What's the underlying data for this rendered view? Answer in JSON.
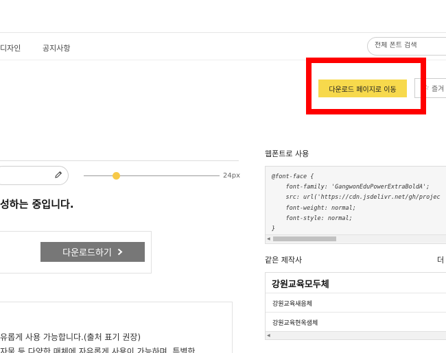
{
  "nav": {
    "items": [
      {
        "label": "디자인"
      },
      {
        "label": "공지사항"
      }
    ]
  },
  "search": {
    "placeholder": "전체 폰트 검색"
  },
  "actions": {
    "download_page_label": "다운로드 페이지로 이동",
    "favorite_label": "즐겨"
  },
  "tester": {
    "size_label": "24px",
    "preview_text": "성하는 중입니다."
  },
  "download": {
    "label": "다운로드하기"
  },
  "license": {
    "lines": [
      "유롭게 사용 가능합니다.(출처 표기 권장)",
      "자물 등 다양한 매체에 자유롭게 사용이 가능하며, 특별한"
    ]
  },
  "webfont": {
    "heading": "웹폰트로 사용",
    "code": "@font-face {\n    font-family: 'GangwonEduPowerExtraBoldA';\n    src: url('https://cdn.jsdelivr.net/gh/projec\n    font-weight: normal;\n    font-style: normal;\n}"
  },
  "same_maker": {
    "heading": "같은 제작사",
    "more_label": "더",
    "title": "강원교육모두체",
    "items": [
      "강원교육새음체",
      "강원교육현옥샘체"
    ]
  },
  "colors": {
    "accent": "#f7d94c",
    "highlight": "#ff0000",
    "button_gray": "#777777"
  },
  "icons": [
    "pencil-icon",
    "chevron-right-icon",
    "star-icon",
    "scroll-left-icon",
    "scroll-right-icon"
  ]
}
